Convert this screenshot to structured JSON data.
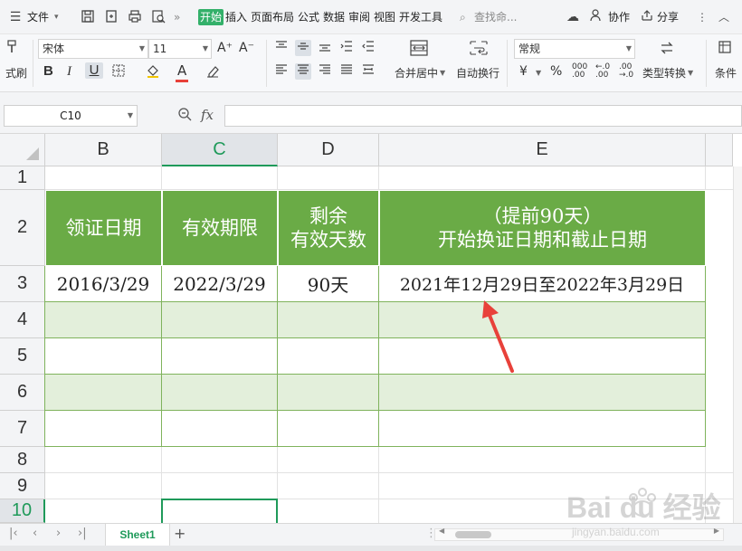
{
  "menubar": {
    "file_label": "文件",
    "tabs": [
      "开始",
      "插入",
      "页面布局",
      "公式",
      "数据",
      "审阅",
      "视图",
      "开发工具"
    ],
    "search_placeholder": "查找命...",
    "collab_label": "协作",
    "share_label": "分享"
  },
  "ribbon": {
    "clipboard_label": "式刷",
    "font_name": "宋体",
    "font_size": "11",
    "bold": "B",
    "italic": "I",
    "underline": "U",
    "merge_center_label": "合并居中",
    "wrap_text_label": "自动换行",
    "number_format": "常规",
    "percent": "%",
    "type_convert_label": "类型转换",
    "conditional_label": "条件"
  },
  "formula_bar": {
    "name_box": "C10",
    "fx_label": "fx",
    "formula": ""
  },
  "grid": {
    "columns": [
      "B",
      "C",
      "D",
      "E"
    ],
    "selected_column": "C",
    "rows": [
      "1",
      "2",
      "3",
      "4",
      "5",
      "6",
      "7",
      "8",
      "9",
      "10"
    ],
    "selected_row": "10"
  },
  "table": {
    "headers": {
      "b": "领证日期",
      "c": "有效期限",
      "d_line1": "剩余",
      "d_line2": "有效天数",
      "e_line1": "（提前90天）",
      "e_line2": "开始换证日期和截止日期"
    },
    "row3": {
      "b": "2016/3/29",
      "c": "2022/3/29",
      "d": "90天",
      "e": "2021年12月29日至2022年3月29日"
    },
    "header_color": "#6aab46",
    "band_color": "#e3efdb"
  },
  "sheets": {
    "active": "Sheet1",
    "add_label": "+"
  },
  "watermark": {
    "line1": "Bai du 经验",
    "line2": "jingyan.baidu.com"
  },
  "colors": {
    "accent": "#1f9a5a",
    "arrow": "#e8413a"
  }
}
